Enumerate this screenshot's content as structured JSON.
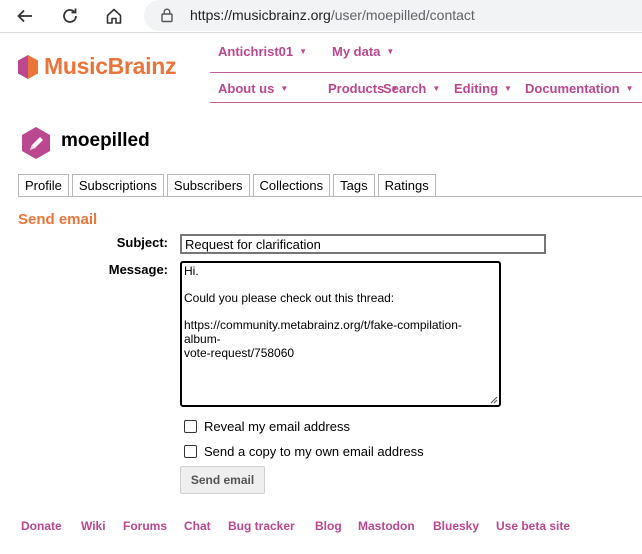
{
  "browser": {
    "url_domain": "https://musicbrainz.org",
    "url_path": "/user/moepilled/contact"
  },
  "header": {
    "logo_text": "MusicBrainz",
    "user_menu": [
      "Antichrist01",
      "My data"
    ],
    "main_menu": [
      "About us",
      "Products",
      "Search",
      "Editing",
      "Documentation"
    ]
  },
  "profile": {
    "username": "moepilled",
    "tabs": [
      "Profile",
      "Subscriptions",
      "Subscribers",
      "Collections",
      "Tags",
      "Ratings"
    ]
  },
  "form": {
    "section_title": "Send email",
    "subject_label": "Subject:",
    "subject_value": "Request for clarification",
    "message_label": "Message:",
    "message_lines": {
      "greeting": "Hi.",
      "body": "Could you please check out this thread:",
      "link_line1": "https://community.metabrainz.org/t/fake-compilation-album-",
      "link_line2": "vote-request/758060"
    },
    "reveal_email_label": "Reveal my email address",
    "send_copy_label": "Send a copy to my own email address",
    "send_button": "Send email"
  },
  "footer": {
    "links": [
      "Donate",
      "Wiki",
      "Forums",
      "Chat",
      "Bug tracker",
      "Blog",
      "Mastodon",
      "Bluesky",
      "Use beta site"
    ]
  },
  "colors": {
    "brand_orange": "#eb743b",
    "brand_purple": "#ba478f"
  }
}
